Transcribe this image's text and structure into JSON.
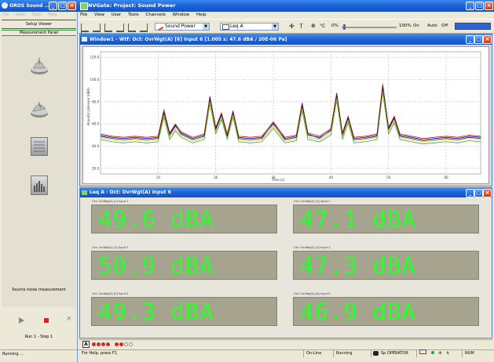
{
  "left_window": {
    "title": "OROS Sound ...",
    "menu": [
      "File",
      "View",
      "Tools",
      "Help"
    ],
    "setup_viewer_label": "Setup Viewer",
    "measurement_panel_label": "Measurement Panel",
    "source_noise_label": "Source noise measurement",
    "run_step_label": "Run 1 - Step 1",
    "status_text": "Running ..."
  },
  "main_window": {
    "title": "NVGate: Project: Sound Power",
    "menu": [
      "File",
      "View",
      "User",
      "Tools",
      "Channels",
      "Window",
      "Help"
    ],
    "toolbar": {
      "project_combo": "Sound Power",
      "leq_combo": "Leq A",
      "slider_left": "0%",
      "slider_right": "100%",
      "on_label": "On",
      "auto_label": "Auto",
      "off_label": "Off"
    },
    "status_bar": {
      "help_text": "For Help, press F1",
      "online": "On-Line",
      "running": "Running",
      "operator": "Sp OPERATOR",
      "num": "NUM"
    }
  },
  "graph_window": {
    "title": "Window1 - Wtf: Oct: OvrWgt(A) [6] Input 6 [1.005 s: 47.6 dBA / 20E-06 Pa]",
    "ylabel": "Acoustic pressure (dBA)",
    "xlabel": "Time (s)",
    "y_ticks": [
      "120.0",
      "100.0",
      "80.0",
      "60.0",
      "40.0",
      "20.0"
    ],
    "x_ticks": [
      "10",
      "20",
      "30",
      "40",
      "50",
      "60"
    ]
  },
  "chart_data": {
    "type": "line",
    "xlabel": "Time (s)",
    "ylabel": "Acoustic pressure (dBA)",
    "xlim": [
      0,
      66
    ],
    "ylim": [
      15,
      125
    ],
    "grid": true,
    "x": [
      0,
      2,
      4,
      6,
      8,
      10,
      11,
      12,
      13,
      14,
      16,
      18,
      19,
      20,
      21,
      22,
      23,
      24,
      26,
      28,
      30,
      32,
      34,
      35,
      36,
      38,
      40,
      41,
      42,
      43,
      44,
      46,
      48,
      49,
      50,
      51,
      52,
      54,
      56,
      58,
      60,
      62,
      64,
      66
    ],
    "series": [
      {
        "color": "#1a1acc",
        "values": [
          50,
          48,
          47,
          48,
          47,
          48,
          70,
          50,
          58,
          52,
          47,
          50,
          82,
          55,
          68,
          50,
          70,
          48,
          47,
          48,
          60,
          47,
          49,
          76,
          50,
          48,
          54,
          85,
          50,
          65,
          47,
          48,
          50,
          93,
          55,
          65,
          50,
          48,
          46,
          47,
          48,
          47,
          49,
          48
        ]
      },
      {
        "color": "#cc2222",
        "values": [
          51,
          49,
          48,
          49,
          48,
          49,
          73,
          52,
          60,
          53,
          48,
          51,
          85,
          57,
          70,
          51,
          72,
          49,
          48,
          49,
          62,
          48,
          50,
          79,
          52,
          49,
          56,
          88,
          52,
          67,
          48,
          49,
          51,
          96,
          57,
          67,
          51,
          49,
          47,
          48,
          49,
          48,
          50,
          49
        ]
      },
      {
        "color": "#33aa33",
        "values": [
          46,
          44,
          43,
          44,
          43,
          44,
          66,
          46,
          54,
          48,
          43,
          46,
          78,
          51,
          64,
          46,
          66,
          44,
          43,
          44,
          56,
          43,
          45,
          72,
          46,
          44,
          50,
          81,
          46,
          61,
          43,
          44,
          46,
          88,
          51,
          61,
          46,
          44,
          42,
          43,
          44,
          43,
          45,
          44
        ]
      },
      {
        "color": "#d8b21a",
        "values": [
          48,
          46,
          45,
          46,
          45,
          46,
          68,
          48,
          56,
          50,
          45,
          48,
          80,
          53,
          66,
          48,
          68,
          46,
          45,
          46,
          58,
          45,
          47,
          74,
          48,
          46,
          52,
          83,
          48,
          63,
          45,
          46,
          48,
          90,
          53,
          63,
          48,
          46,
          44,
          45,
          46,
          45,
          47,
          46
        ]
      },
      {
        "color": "#222222",
        "values": [
          49,
          47,
          46,
          47,
          46,
          47,
          71,
          51,
          59,
          51,
          46,
          49,
          84,
          56,
          69,
          49,
          71,
          47,
          46,
          47,
          61,
          46,
          48,
          78,
          51,
          47,
          55,
          87,
          51,
          66,
          46,
          47,
          49,
          94,
          56,
          66,
          49,
          47,
          45,
          46,
          47,
          46,
          48,
          47
        ]
      }
    ]
  },
  "leq_window": {
    "title": "Leq A - Oct: OvrWgt(A) Input 6",
    "meters": [
      {
        "label": "Oct: OvrWgt(A) [1] Input 1",
        "value": "49.6 dBA"
      },
      {
        "label": "Oct: OvrWgt(A) [2] Input 2",
        "value": "47.1 dBA"
      },
      {
        "label": "Oct: OvrWgt(A) [3] Input 3",
        "value": "50.9 dBA"
      },
      {
        "label": "Oct: OvrWgt(A) [4] Input 4",
        "value": "47.3 dBA"
      },
      {
        "label": "Oct: OvrWgt(A) [5] Input 5",
        "value": "49.3 dBA"
      },
      {
        "label": "Oct: OvrWgt(A) [6] Input 6",
        "value": "46.9 dBA"
      }
    ],
    "tab_label": "A",
    "meter_color": "#2bff2b",
    "meter_bg": "#a6a38f"
  }
}
